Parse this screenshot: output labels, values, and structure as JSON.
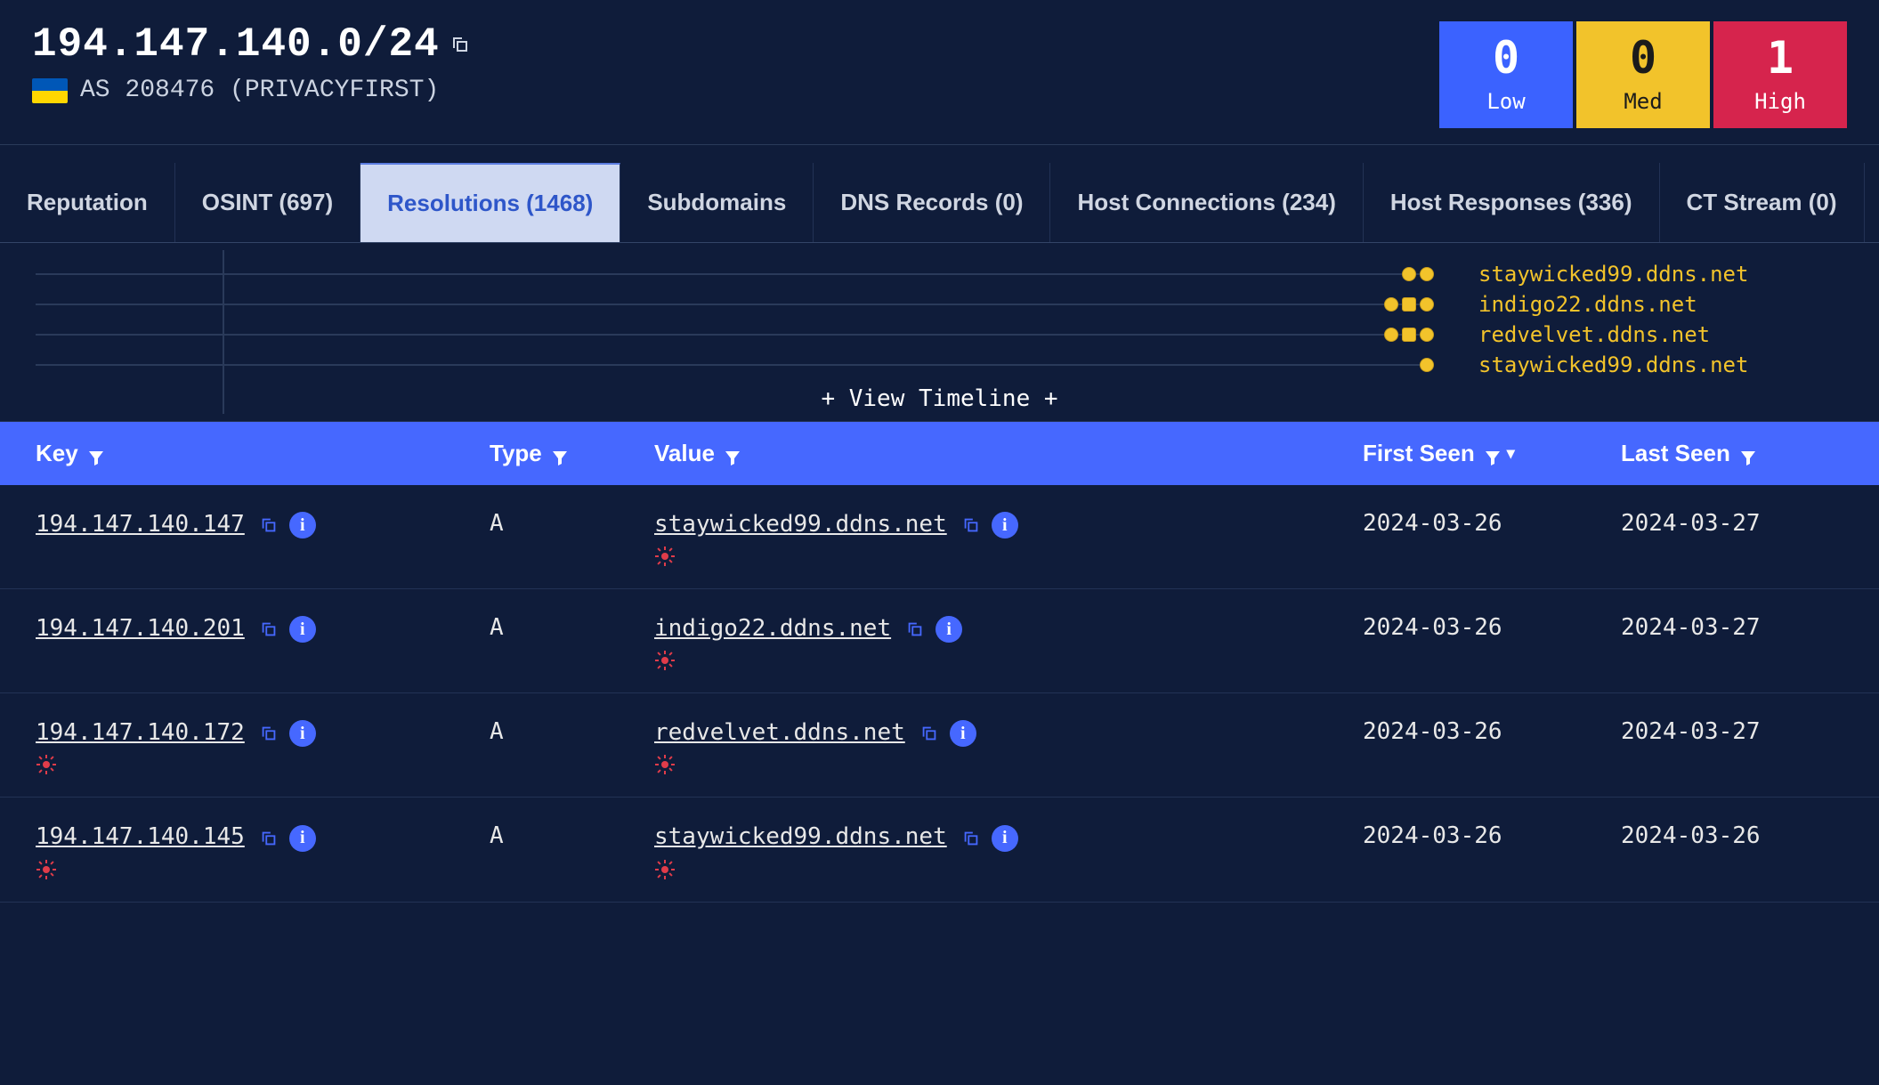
{
  "header": {
    "title": "194.147.140.0/24",
    "as_text": "AS 208476 (PRIVACYFIRST)",
    "country_code": "UA"
  },
  "severity": {
    "low": {
      "count": "0",
      "label": "Low"
    },
    "med": {
      "count": "0",
      "label": "Med"
    },
    "high": {
      "count": "1",
      "label": "High"
    }
  },
  "tabs": [
    {
      "id": "reputation",
      "label": "Reputation",
      "active": false
    },
    {
      "id": "osint",
      "label": "OSINT (697)",
      "active": false
    },
    {
      "id": "resolutions",
      "label": "Resolutions (1468)",
      "active": true
    },
    {
      "id": "subdomains",
      "label": "Subdomains",
      "active": false
    },
    {
      "id": "dns",
      "label": "DNS Records (0)",
      "active": false
    },
    {
      "id": "hostconn",
      "label": "Host Connections (234)",
      "active": false
    },
    {
      "id": "hostresp",
      "label": "Host Responses (336)",
      "active": false
    },
    {
      "id": "ctstream",
      "label": "CT Stream (0)",
      "active": false
    }
  ],
  "timeline": {
    "rows": [
      {
        "label": "staywicked99.ddns.net",
        "dots": [
          "dot",
          "dot"
        ]
      },
      {
        "label": "indigo22.ddns.net",
        "dots": [
          "dot",
          "sq",
          "dot"
        ]
      },
      {
        "label": "redvelvet.ddns.net",
        "dots": [
          "dot",
          "sq",
          "dot"
        ]
      },
      {
        "label": "staywicked99.ddns.net",
        "dots": [
          "dot"
        ]
      }
    ],
    "expand_label": "+ View Timeline +"
  },
  "columns": {
    "key": "Key",
    "type": "Type",
    "value": "Value",
    "first_seen": "First Seen",
    "last_seen": "Last Seen"
  },
  "rows": [
    {
      "key": "194.147.140.147",
      "key_malware": false,
      "type": "A",
      "value": "staywicked99.ddns.net",
      "value_malware": true,
      "first_seen": "2024-03-26",
      "last_seen": "2024-03-27"
    },
    {
      "key": "194.147.140.201",
      "key_malware": false,
      "type": "A",
      "value": "indigo22.ddns.net",
      "value_malware": true,
      "first_seen": "2024-03-26",
      "last_seen": "2024-03-27"
    },
    {
      "key": "194.147.140.172",
      "key_malware": true,
      "type": "A",
      "value": "redvelvet.ddns.net",
      "value_malware": true,
      "first_seen": "2024-03-26",
      "last_seen": "2024-03-27"
    },
    {
      "key": "194.147.140.145",
      "key_malware": true,
      "type": "A",
      "value": "staywicked99.ddns.net",
      "value_malware": true,
      "first_seen": "2024-03-26",
      "last_seen": "2024-03-26"
    }
  ]
}
